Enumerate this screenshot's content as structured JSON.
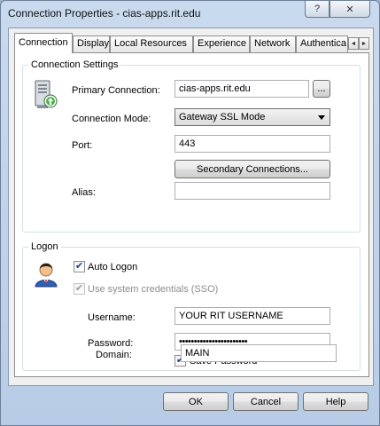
{
  "window": {
    "title": "Connection Properties - cias-apps.rit.edu",
    "help_glyph": "?",
    "close_glyph": "✕"
  },
  "tabs": [
    {
      "label": "Connection",
      "active": true
    },
    {
      "label": "Display"
    },
    {
      "label": "Local Resources"
    },
    {
      "label": "Experience"
    },
    {
      "label": "Network"
    },
    {
      "label": "Authentica"
    }
  ],
  "tab_scroll": {
    "left": "◄",
    "right": "►"
  },
  "connection_settings": {
    "title": "Connection Settings",
    "icon": "server-upload-icon",
    "primary_label": "Primary Connection:",
    "primary_value": "cias-apps.rit.edu",
    "browse_label": "...",
    "mode_label": "Connection Mode:",
    "mode_value": "Gateway SSL Mode",
    "port_label": "Port:",
    "port_value": "443",
    "secondary_button": "Secondary Connections...",
    "alias_label": "Alias:",
    "alias_value": ""
  },
  "logon": {
    "title": "Logon",
    "icon": "user-icon",
    "auto_logon_label": "Auto Logon",
    "auto_logon_checked": true,
    "sso_label": "Use system credentials (SSO)",
    "sso_checked": true,
    "username_label": "Username:",
    "username_value": "YOUR RIT USERNAME",
    "password_label": "Password:",
    "password_value": "•••••••••••••••••••••••",
    "save_password_label": "Save Password",
    "save_password_checked": true,
    "domain_label": "Domain:",
    "domain_value": "MAIN"
  },
  "footer": {
    "ok": "OK",
    "cancel": "Cancel",
    "help": "Help"
  }
}
